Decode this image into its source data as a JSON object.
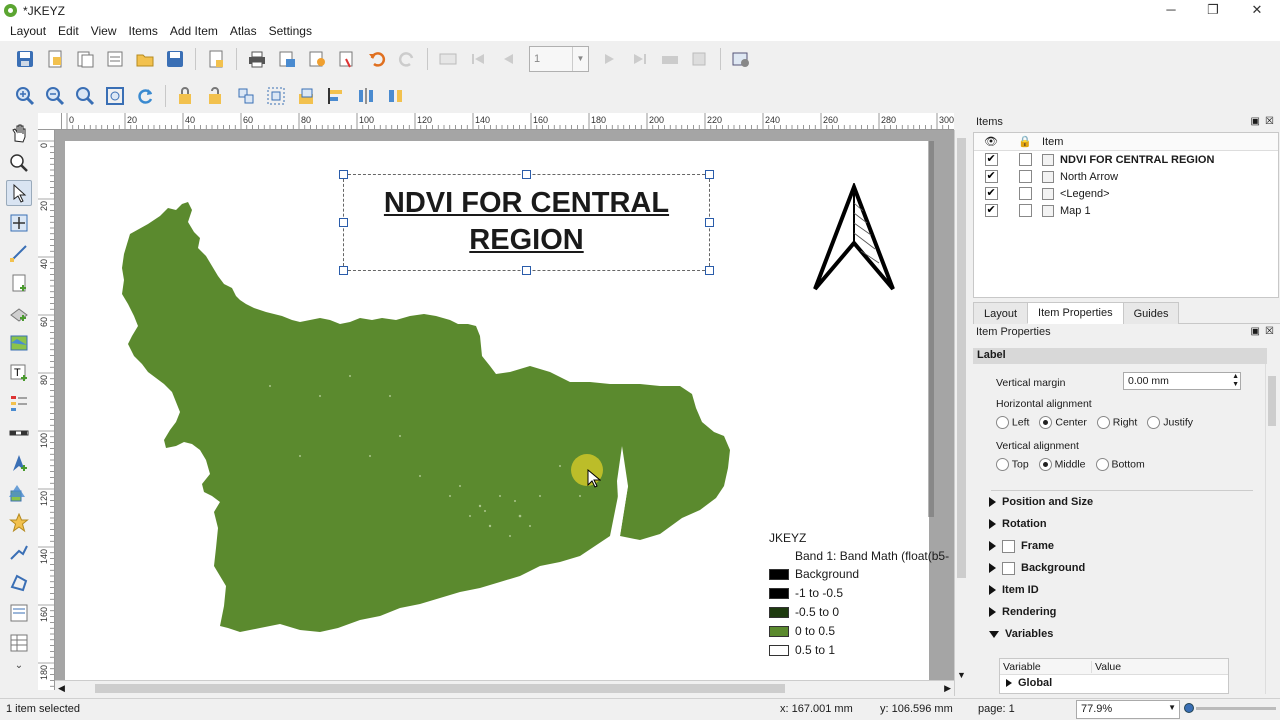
{
  "window": {
    "title": "*JKEYZ",
    "minimize": "─",
    "maximize": "❐",
    "close": "✕"
  },
  "menu": [
    "Layout",
    "Edit",
    "View",
    "Items",
    "Add Item",
    "Atlas",
    "Settings"
  ],
  "toolbar": {
    "page_value": "1"
  },
  "layout": {
    "title_line1": "NDVI FOR CENTRAL",
    "title_line2": "REGION",
    "legend": {
      "title": "JKEYZ",
      "band": "Band 1: Band Math (float(b5-",
      "items": [
        {
          "label": "Background",
          "color": "#000000"
        },
        {
          "label": "-1 to -0.5",
          "color": "#000000"
        },
        {
          "label": "-0.5 to 0",
          "color": "#1e3a0f"
        },
        {
          "label": "0 to 0.5",
          "color": "#5b8a2e"
        },
        {
          "label": "0.5 to 1",
          "color": "#ffffff"
        }
      ]
    },
    "map_color": "#5b8a2e"
  },
  "ruler_h": [
    "0",
    "20",
    "40",
    "60",
    "80",
    "100",
    "120",
    "140",
    "160",
    "180",
    "200",
    "220",
    "240",
    "260",
    "280",
    "300"
  ],
  "ruler_v": [
    "0",
    "20",
    "40",
    "60",
    "80",
    "100",
    "120",
    "140",
    "160",
    "180"
  ],
  "items_panel": {
    "title": "Items",
    "col_item": "Item",
    "rows": [
      {
        "label": "NDVI FOR CENTRAL REGION",
        "icon": "text-icon",
        "bold": true
      },
      {
        "label": "North Arrow",
        "icon": "picture-icon",
        "bold": false
      },
      {
        "label": "<Legend>",
        "icon": "legend-icon",
        "bold": false
      },
      {
        "label": "Map 1",
        "icon": "map-icon",
        "bold": false
      }
    ]
  },
  "tabs": [
    "Layout",
    "Item Properties",
    "Guides"
  ],
  "props": {
    "title": "Item Properties",
    "section": "Label",
    "vmargin_label": "Vertical margin",
    "vmargin_value": "0.00 mm",
    "halign_label": "Horizontal alignment",
    "halign": [
      "Left",
      "Center",
      "Right",
      "Justify"
    ],
    "valign_label": "Vertical alignment",
    "valign": [
      "Top",
      "Middle",
      "Bottom"
    ],
    "groups": [
      "Position and Size",
      "Rotation",
      "Frame",
      "Background",
      "Item ID",
      "Rendering",
      "Variables"
    ],
    "var_col1": "Variable",
    "var_col2": "Value",
    "var_row": "Global"
  },
  "status": {
    "selected": "1 item selected",
    "x": "x: 167.001 mm",
    "y": "y: 106.596 mm",
    "page": "page: 1",
    "zoom": "77.9%"
  }
}
